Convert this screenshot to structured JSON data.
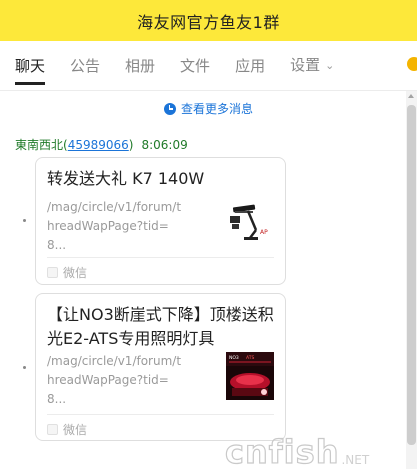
{
  "header": {
    "title": "海友网官方鱼友1群"
  },
  "tabs": [
    {
      "label": "聊天",
      "active": true
    },
    {
      "label": "公告"
    },
    {
      "label": "相册"
    },
    {
      "label": "文件"
    },
    {
      "label": "应用"
    },
    {
      "label": "设置",
      "has_dropdown": true
    }
  ],
  "load_more": {
    "label": "查看更多消息",
    "icon": "clock-icon"
  },
  "message": {
    "sender_name": "東南西北",
    "sender_id_open": "(",
    "sender_id": "45989066",
    "sender_id_close": ")",
    "time": "8:06:09"
  },
  "cards": [
    {
      "title": "转发送大礼 K7 140W",
      "description": "/mag/circle/v1/forum/threadWapPage?tid=8...",
      "source": "微信",
      "thumb_icon": "lamp-product-icon"
    },
    {
      "title": "【让NO3断崖式下降】顶楼送积光E2-ATS专用照明灯具",
      "description": "/mag/circle/v1/forum/threadWapPage?tid=8...",
      "source": "微信",
      "thumb_icon": "red-light-product-icon"
    }
  ],
  "watermark": {
    "main": "cnfish",
    "suffix": ".NET"
  },
  "colors": {
    "header_bg": "#fde83a",
    "link": "#1b74d8",
    "sender": "#1f7a28",
    "accent_dot": "#f4b400"
  }
}
